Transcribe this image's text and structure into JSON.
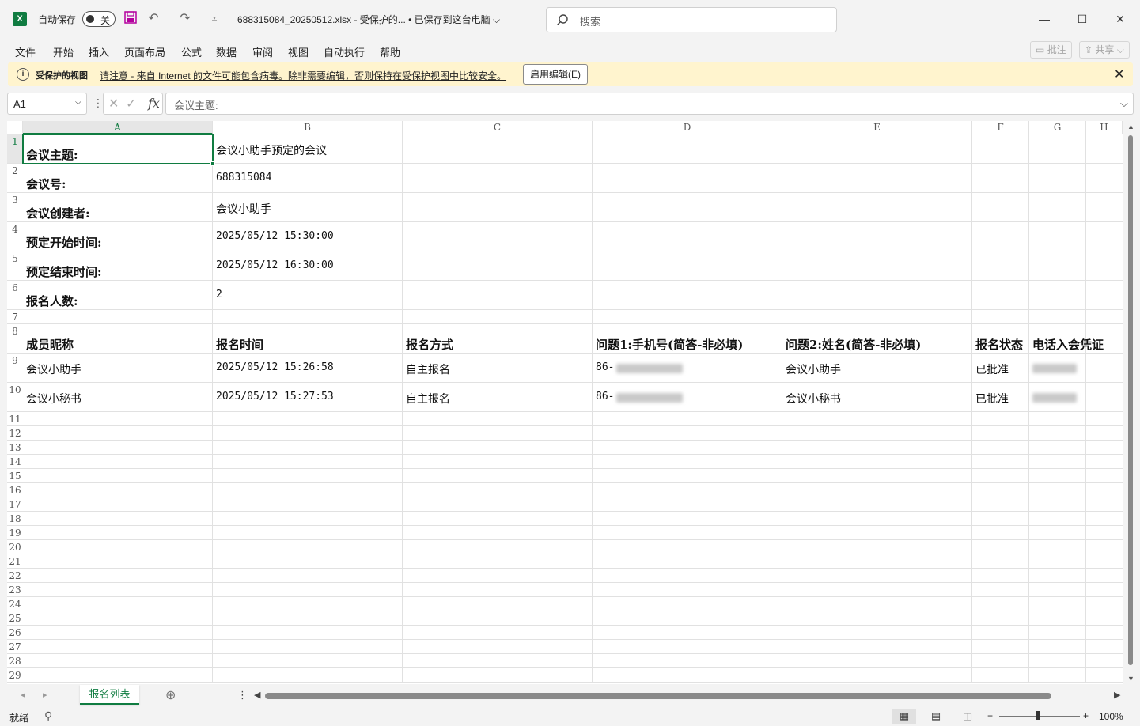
{
  "titlebar": {
    "app_icon_letter": "X",
    "autosave_label": "自动保存",
    "autosave_state": "关",
    "doc_title": "688315084_20250512.xlsx  -  受保护的...   • 已保存到这台电脑 ⌵",
    "search_placeholder": "搜索",
    "minimize": "—",
    "maximize": "☐",
    "close": "✕"
  },
  "menu": {
    "items": [
      "文件",
      "开始",
      "插入",
      "页面布局",
      "公式",
      "数据",
      "审阅",
      "视图",
      "自动执行",
      "帮助"
    ],
    "comment_btn": "批注",
    "share_btn": "共享"
  },
  "protected_view": {
    "title": "受保护的视图",
    "message": "请注意 - 来自 Internet 的文件可能包含病毒。除非需要编辑，否则保持在受保护视图中比较安全。",
    "enable_button": "启用编辑(E)"
  },
  "formula_bar": {
    "name_box": "A1",
    "fx": "fx",
    "formula": "会议主题:"
  },
  "columns": [
    "A",
    "B",
    "C",
    "D",
    "E",
    "F",
    "G",
    "H"
  ],
  "rows": [
    "1",
    "2",
    "3",
    "4",
    "5",
    "6",
    "7",
    "8",
    "9",
    "10",
    "11",
    "12",
    "13",
    "14",
    "15",
    "16",
    "17",
    "18",
    "19",
    "20",
    "21",
    "22",
    "23",
    "24",
    "25",
    "26",
    "27",
    "28",
    "29"
  ],
  "cells": {
    "A1": "会议主题:",
    "B1": "会议小助手预定的会议",
    "A2": "会议号:",
    "B2": "688315084",
    "A3": "会议创建者:",
    "B3": "会议小助手",
    "A4": "预定开始时间:",
    "B4": "2025/05/12 15:30:00",
    "A5": "预定结束时间:",
    "B5": "2025/05/12 16:30:00",
    "A6": "报名人数:",
    "B6": "2",
    "A8": "成员昵称",
    "B8": "报名时间",
    "C8": "报名方式",
    "D8": "问题1:手机号(简答-非必填)",
    "E8": "问题2:姓名(简答-非必填)",
    "F8": "报名状态",
    "G8": "电话入会凭证",
    "A9": "会议小助手",
    "B9": "2025/05/12 15:26:58",
    "C9": "自主报名",
    "D9": "86-",
    "E9": "会议小助手",
    "F9": "已批准",
    "A10": "会议小秘书",
    "B10": "2025/05/12 15:27:53",
    "C10": "自主报名",
    "D10": "86-",
    "E10": "会议小秘书",
    "F10": "已批准"
  },
  "sheet_tabs": {
    "active": "报名列表",
    "add": "⊕"
  },
  "statusbar": {
    "ready": "就绪",
    "zoom_minus": "−",
    "zoom_plus": "+",
    "zoom": "100%"
  }
}
